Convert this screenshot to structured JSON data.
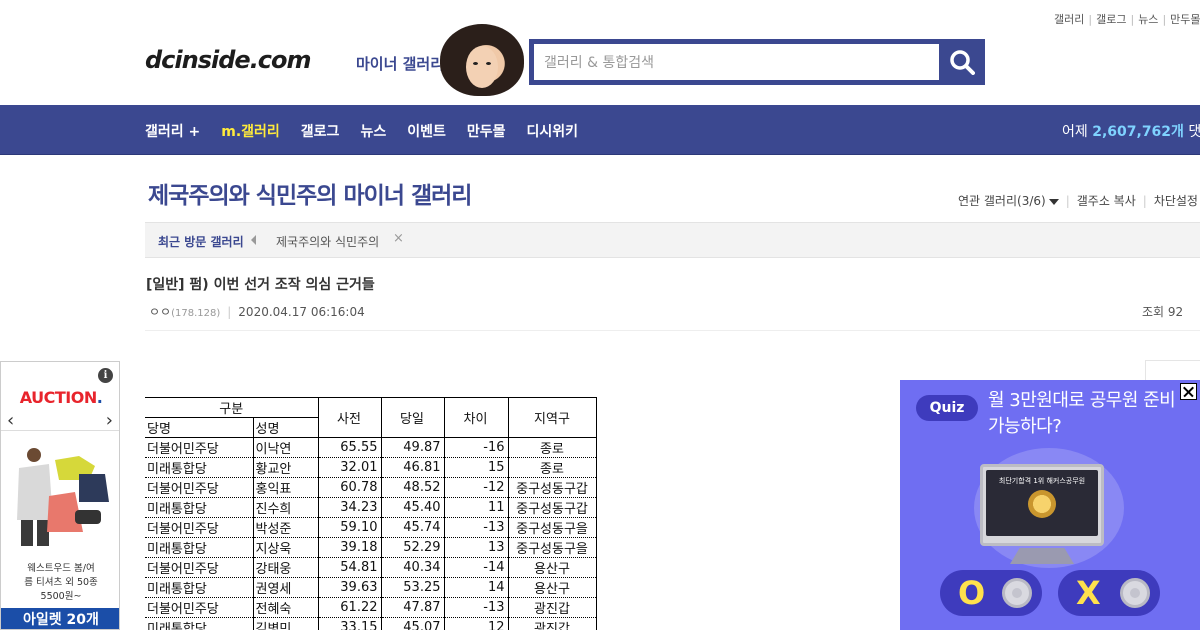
{
  "top_links": [
    "갤러리",
    "갤로그",
    "뉴스",
    "만두몰"
  ],
  "header": {
    "logo": "dcinside.com",
    "logo_sub": "마이너 갤러리",
    "search_placeholder": "갤러리 & 통합검색"
  },
  "nav": {
    "items": [
      "갤러리 +",
      "m.갤러리",
      "갤로그",
      "뉴스",
      "이벤트",
      "만두몰",
      "디시위키"
    ],
    "stats_label": "어제",
    "stats_value": "2,607,762개",
    "stats_suffix": "댓글"
  },
  "gallery": {
    "title": "제국주의와 식민주의 마이너 갤러리",
    "tools": [
      "연관 갤러리(3/6)",
      "갤주소 복사",
      "차단설정"
    ]
  },
  "recent": {
    "label": "최근 방문 갤러리",
    "entry": "제국주의와 식민주의",
    "remove": "×"
  },
  "post": {
    "title": "[일반] 펌) 이번 선거 조작 의심 근거들",
    "author": "ㅇㅇ",
    "ip": "(178.128)",
    "datetime": "2020.04.17 06:16:04",
    "views": "조회 92"
  },
  "table": {
    "header": {
      "group": "구분",
      "party": "당명",
      "name": "성명",
      "pre": "사전",
      "day": "당일",
      "diff": "차이",
      "region": "지역구"
    },
    "rows": [
      {
        "party": "더불어민주당",
        "name": "이낙연",
        "pre": "65.55",
        "day": "49.87",
        "diff": "-16",
        "region": "종로"
      },
      {
        "party": "미래통합당",
        "name": "황교안",
        "pre": "32.01",
        "day": "46.81",
        "diff": "15",
        "region": "종로"
      },
      {
        "party": "더불어민주당",
        "name": "홍익표",
        "pre": "60.78",
        "day": "48.52",
        "diff": "-12",
        "region": "중구성동구갑"
      },
      {
        "party": "미래통합당",
        "name": "진수희",
        "pre": "34.23",
        "day": "45.40",
        "diff": "11",
        "region": "중구성동구갑"
      },
      {
        "party": "더불어민주당",
        "name": "박성준",
        "pre": "59.10",
        "day": "45.74",
        "diff": "-13",
        "region": "중구성동구을"
      },
      {
        "party": "미래통합당",
        "name": "지상욱",
        "pre": "39.18",
        "day": "52.29",
        "diff": "13",
        "region": "중구성동구을"
      },
      {
        "party": "더불어민주당",
        "name": "강태웅",
        "pre": "54.81",
        "day": "40.34",
        "diff": "-14",
        "region": "용산구"
      },
      {
        "party": "미래통합당",
        "name": "권영세",
        "pre": "39.63",
        "day": "53.25",
        "diff": "14",
        "region": "용산구"
      },
      {
        "party": "더불어민주당",
        "name": "전혜숙",
        "pre": "61.22",
        "day": "47.87",
        "diff": "-13",
        "region": "광진갑"
      },
      {
        "party": "미래통합당",
        "name": "김병민",
        "pre": "33.15",
        "day": "45.07",
        "diff": "12",
        "region": "광진갑"
      }
    ]
  },
  "left_ad": {
    "brand": "AUCTION",
    "brand_dot": ".",
    "info": "i",
    "desc_line1": "웨스트우드 봄/여",
    "desc_line2": "름 티셔츠 외 50종",
    "desc_line3": "5500원~",
    "cta": "아일렛 20개"
  },
  "quiz_ad": {
    "badge": "Quiz",
    "question": "월 3만원대로 공무원 준비 가능하다?",
    "screen_text": "최단기합격 1위 해커스공무원",
    "option_o": "O",
    "option_x": "X"
  },
  "colors": {
    "brand_blue": "#3b4890",
    "active_nav": "#ffeb3b",
    "stats_num": "#7fd3ff",
    "quiz_bg": "#6f6ef2"
  }
}
